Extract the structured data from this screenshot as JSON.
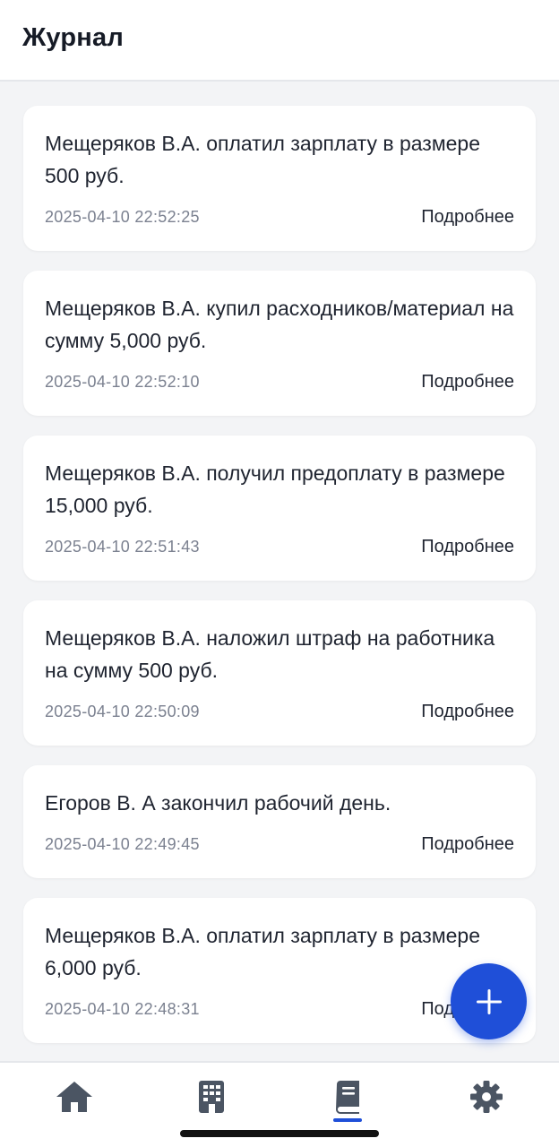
{
  "header": {
    "title": "Журнал"
  },
  "entries": [
    {
      "text": "Мещеряков В.А. оплатил зарплату в размере 500 руб.",
      "time": "2025-04-10 22:52:25",
      "more": "Подробнее"
    },
    {
      "text": "Мещеряков В.А. купил расходников/материал на сумму 5,000 руб.",
      "time": "2025-04-10 22:52:10",
      "more": "Подробнее"
    },
    {
      "text": "Мещеряков В.А. получил предоплату в размере 15,000 руб.",
      "time": "2025-04-10 22:51:43",
      "more": "Подробнее"
    },
    {
      "text": "Мещеряков В.А. наложил штраф на работника на сумму 500 руб.",
      "time": "2025-04-10 22:50:09",
      "more": "Подробнее"
    },
    {
      "text": "Егоров В. А закончил рабочий день.",
      "time": "2025-04-10 22:49:45",
      "more": "Подробнее"
    },
    {
      "text": "Мещеряков В.А. оплатил зарплату в размере 6,000 руб.",
      "time": "2025-04-10 22:48:31",
      "more": "Подробнее"
    }
  ],
  "fab": {
    "icon": "plus-icon"
  },
  "tabbar": {
    "items": [
      {
        "icon": "home-icon",
        "active": false
      },
      {
        "icon": "building-icon",
        "active": false
      },
      {
        "icon": "journal-book-icon",
        "active": true
      },
      {
        "icon": "gear-icon",
        "active": false
      }
    ]
  },
  "colors": {
    "accent": "#1f4fd8",
    "icon_inactive": "#4b5563",
    "background": "#f3f4f6",
    "card": "#ffffff"
  }
}
